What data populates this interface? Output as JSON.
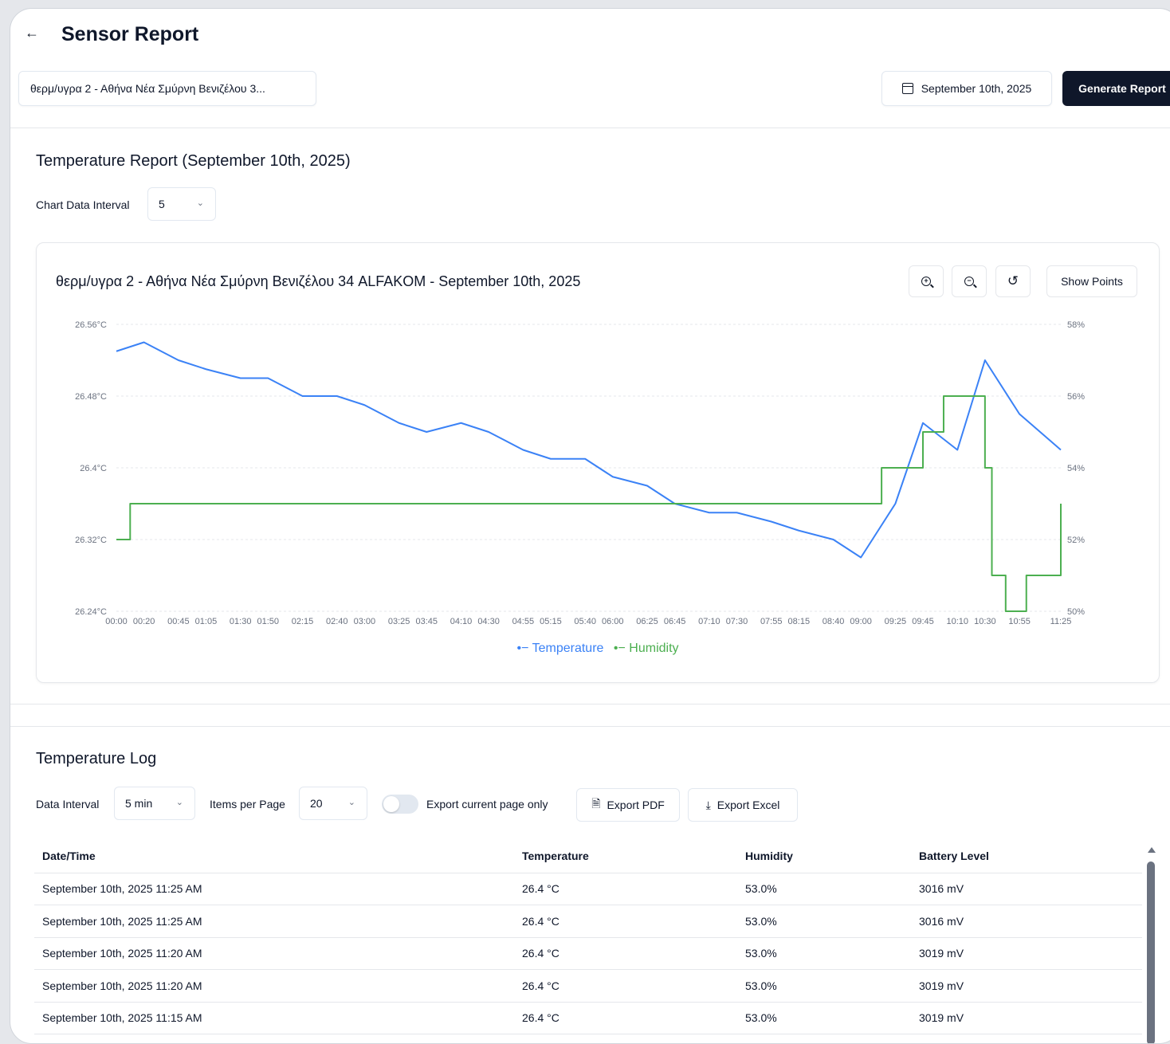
{
  "header": {
    "back_icon": "arrow-left-icon",
    "title": "Sensor Report",
    "sensor_select": "θερμ/υγρα 2 - Αθήνα Νέα Σμύρνη Βενιζέλου 3...",
    "date": "September 10th, 2025",
    "generate_label": "Generate Report"
  },
  "report": {
    "title": "Temperature Report (September 10th, 2025)",
    "interval_label": "Chart Data Interval",
    "interval_value": "5"
  },
  "chart_card": {
    "title": "θερμ/υγρα 2 - Αθήνα Νέα Σμύρνη Βενιζέλου 34 ALFAKOM - September 10th, 2025",
    "zoom_in_icon": "zoom-in-icon",
    "zoom_out_icon": "zoom-out-icon",
    "reset_icon": "reset-icon",
    "show_points_label": "Show Points"
  },
  "chart_data": {
    "type": "line",
    "x_ticks": [
      "00:00",
      "00:20",
      "00:45",
      "01:05",
      "01:30",
      "01:50",
      "02:15",
      "02:40",
      "03:00",
      "03:25",
      "03:45",
      "04:10",
      "04:30",
      "04:55",
      "05:15",
      "05:40",
      "06:00",
      "06:25",
      "06:45",
      "07:10",
      "07:30",
      "07:55",
      "08:15",
      "08:40",
      "09:00",
      "09:25",
      "09:45",
      "10:10",
      "10:30",
      "10:55",
      "11:25"
    ],
    "y_left_ticks": [
      "26.56°C",
      "26.48°C",
      "26.4°C",
      "26.32°C",
      "26.24°C"
    ],
    "y_right_ticks": [
      "58%",
      "56%",
      "54%",
      "52%",
      "50%"
    ],
    "y_left_range": [
      26.24,
      26.56
    ],
    "y_right_range": [
      50,
      58
    ],
    "grid": true,
    "legend_position": "bottom-center",
    "series": [
      {
        "name": "Temperature",
        "axis": "left",
        "color": "#3b82f6",
        "times": [
          "00:00",
          "00:20",
          "00:45",
          "01:05",
          "01:30",
          "01:50",
          "02:15",
          "02:40",
          "03:00",
          "03:25",
          "03:45",
          "04:10",
          "04:30",
          "04:55",
          "05:15",
          "05:40",
          "06:00",
          "06:25",
          "06:45",
          "07:10",
          "07:30",
          "07:55",
          "08:15",
          "08:40",
          "09:00",
          "09:25",
          "09:45",
          "10:10",
          "10:30",
          "10:55",
          "11:25"
        ],
        "values": [
          26.53,
          26.54,
          26.52,
          26.51,
          26.5,
          26.5,
          26.48,
          26.48,
          26.47,
          26.45,
          26.44,
          26.45,
          26.44,
          26.42,
          26.41,
          26.41,
          26.39,
          26.38,
          26.36,
          26.35,
          26.35,
          26.34,
          26.33,
          26.32,
          26.3,
          26.36,
          26.45,
          26.42,
          26.52,
          26.46,
          26.42
        ]
      },
      {
        "name": "Humidity",
        "axis": "right",
        "color": "#4caf50",
        "times": [
          "00:00",
          "00:10",
          "00:15",
          "06:30",
          "07:30",
          "08:00",
          "08:30",
          "09:00",
          "09:15",
          "09:45",
          "10:00",
          "10:15",
          "10:30",
          "10:35",
          "10:45",
          "11:00",
          "11:25"
        ],
        "values": [
          52,
          53,
          53,
          53,
          53,
          53,
          53,
          53,
          54,
          55,
          56,
          56,
          54,
          51,
          50,
          51,
          53
        ]
      }
    ]
  },
  "legend": {
    "temperature": "Temperature",
    "humidity": "Humidity"
  },
  "log": {
    "title": "Temperature Log",
    "data_interval_label": "Data Interval",
    "data_interval_value": "5 min",
    "items_per_page_label": "Items per Page",
    "items_per_page_value": "20",
    "export_current_label": "Export current page only",
    "export_current_on": false,
    "export_pdf_label": "Export PDF",
    "export_excel_label": "Export Excel",
    "columns": [
      "Date/Time",
      "Temperature",
      "Humidity",
      "Battery Level"
    ],
    "rows": [
      [
        "September 10th, 2025 11:25 AM",
        "26.4 °C",
        "53.0%",
        "3016 mV"
      ],
      [
        "September 10th, 2025 11:25 AM",
        "26.4 °C",
        "53.0%",
        "3016 mV"
      ],
      [
        "September 10th, 2025 11:20 AM",
        "26.4 °C",
        "53.0%",
        "3019 mV"
      ],
      [
        "September 10th, 2025 11:20 AM",
        "26.4 °C",
        "53.0%",
        "3019 mV"
      ],
      [
        "September 10th, 2025 11:15 AM",
        "26.4 °C",
        "53.0%",
        "3019 mV"
      ]
    ]
  }
}
